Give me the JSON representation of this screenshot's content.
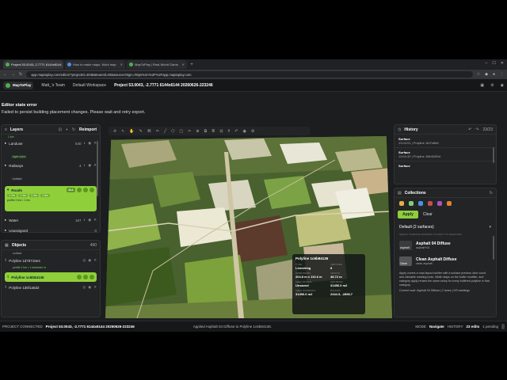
{
  "tabs": [
    {
      "label": "Project 53.0043,-2.7771 6144x6144",
      "active": true
    },
    {
      "label": "How to make maps. Work map",
      "active": false
    },
    {
      "label": "MapToPlay | Real-World Game",
      "active": false
    }
  ],
  "address": {
    "url": "app.maptoplay.com/editor/?projectId=3048&teamId=80&sourceOrigin=https%3A%2F%2Fapp.maptoplay.com"
  },
  "appbar": {
    "logo": "MapToPlay",
    "team": "Matt_'s Team",
    "workspace": "Default Workspace",
    "project": "Project 53.0043, -2.7771 6144x6144 20260626-223246"
  },
  "error": {
    "title": "Editor state error",
    "message": "Failed to persist building placement changes. Please wait and retry export."
  },
  "layers": {
    "title": "Layers",
    "reimport": "Reimport",
    "pre_item": "1 km",
    "items": [
      {
        "name": "Landuse",
        "count": "540",
        "tag": "layer color"
      },
      {
        "name": "Railways",
        "count": "4",
        "tag": "surface"
      },
      {
        "name": "Water",
        "count": "167"
      },
      {
        "name": "Unassigned",
        "count": "0"
      }
    ],
    "roads": {
      "name": "Roads",
      "chips": [
        "1-2m",
        "1-3m",
        "1-4m",
        "1-6m"
      ],
      "sub": "profile 2 km • 1 km",
      "all": "ALL"
    }
  },
  "objects": {
    "title": "Objects",
    "count": "490",
    "sub": "surface",
    "items": [
      {
        "name": "Polyline 1d78718e4",
        "sub": "profile 2 km • 1 meander m"
      },
      {
        "name": "Polyline 1d6f1a5d2"
      }
    ],
    "selected": "Polyline 1c6b84136"
  },
  "toolbar": {
    "icons": [
      "plus",
      "arrow",
      "hand",
      "pen",
      "link",
      "pencil",
      "line",
      "polygon",
      "box",
      "cut",
      "merge",
      "copy",
      "layers",
      "split",
      "grid",
      "undo",
      "eye",
      "settings"
    ]
  },
  "infocard": {
    "title": "Polyline 1c6b84136",
    "fields": [
      {
        "label": "TYPE",
        "value": "Linestring"
      },
      {
        "label": "VERTICES",
        "value": "8"
      },
      {
        "label": "DIMENSIONS",
        "value": "204.8 m x 110.6 m"
      },
      {
        "label": "LENGTH",
        "value": "48.72 m"
      },
      {
        "label": "AREA STATUS",
        "value": "Unsaved"
      },
      {
        "label": "CENTROID",
        "value": "31456.0 m2"
      },
      {
        "label": "AREA ISOMETRIC",
        "value": "31456.0 m2"
      },
      {
        "label": "BOUNDS",
        "value": "2344.9, -2898.7"
      }
    ]
  },
  "history": {
    "title": "History",
    "counter": "23/23",
    "items": [
      {
        "a": "Surface",
        "b": "13:04:01 | Polyline 1fd7e8b6"
      },
      {
        "a": "Surface",
        "b": "13:04:32 | Polyline 1f6b5289d"
      },
      {
        "a": "Surface",
        "b": ""
      }
    ]
  },
  "collections": {
    "title": "Collections",
    "swatches": [
      "#e0b040",
      "#7fd06f",
      "#4a90e2",
      "#c05050",
      "#b050c0",
      "#e08030"
    ],
    "apply": "Apply",
    "clear": "Clear",
    "default": "Default (2 surfaces)",
    "hint": "SELECT SURFACE MATERIAL TO APPLY TO SELECTED",
    "materials": [
      {
        "thumb": "Asphalt",
        "name": "Asphalt 04 Diffuse",
        "sub": "asphalt+04"
      },
      {
        "thumb": "Clean",
        "name": "Clean Asphalt Diffuse",
        "sub": "clean asphalt"
      }
    ],
    "desc": "Apply covers a road layout builder with a surface preview, lane count, and clickable marking tools. Width stays on the buffer modifier, and category apply reuses the same setup for every buffered polyline in that category.",
    "current": "Current road: Asphalt 04 Diffuse | 2 lanes | 0/3 markings"
  },
  "status": {
    "connected": "PROJECT CONNECTED",
    "project": "Project 53.0043, -2.7771 6144x6144 20260626-223246",
    "message": "Applied Asphalt 04 Diffuse to Polyline 1c6b84136.",
    "mode_label": "MODE",
    "mode": "Navigate",
    "history_label": "HISTORY",
    "edits": "23 edits",
    "pending": "1 pending"
  }
}
